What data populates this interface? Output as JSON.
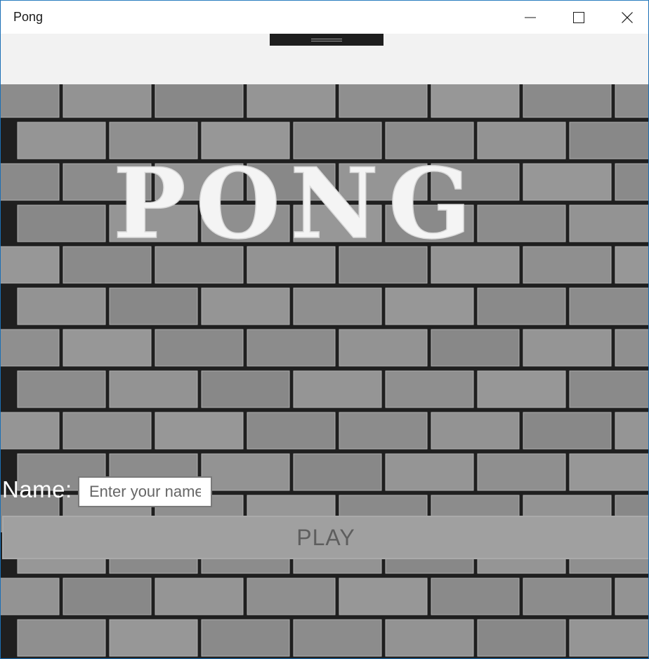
{
  "window": {
    "title": "Pong"
  },
  "icons": {
    "minimize": "minimize-icon",
    "maximize": "maximize-icon",
    "close": "close-icon"
  },
  "game": {
    "logo_text": "PONG"
  },
  "name_field": {
    "label": "Name:",
    "placeholder": "Enter your name",
    "value": ""
  },
  "play_button": {
    "label": "PLAY"
  },
  "colors": {
    "background_wall": "#8e8e8e",
    "mortar": "#1f1f1f",
    "logo": "#f4f4f4",
    "button_bg": "#a0a0a0",
    "button_text": "#5e5e5e",
    "title_bar": "#ffffff"
  }
}
